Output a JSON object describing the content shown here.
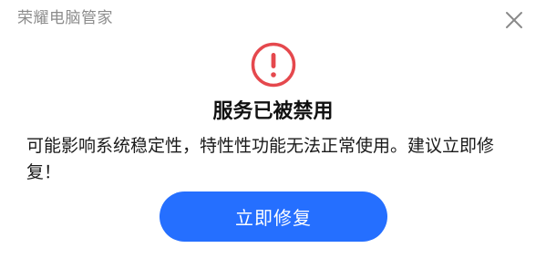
{
  "window": {
    "app_title": "荣耀电脑管家"
  },
  "icons": {
    "close": "close-icon",
    "warning": "exclamation-circle-icon"
  },
  "dialog": {
    "title": "服务已被禁用",
    "message": "可能影响系统稳定性，特性性功能无法正常使用。建议立即修复！",
    "primary_button_label": "立即修复"
  },
  "colors": {
    "warning_red": "#e5484d",
    "primary_blue": "#256fff",
    "title_gray": "#8c8c8c",
    "close_gray": "#8a8a8a"
  }
}
